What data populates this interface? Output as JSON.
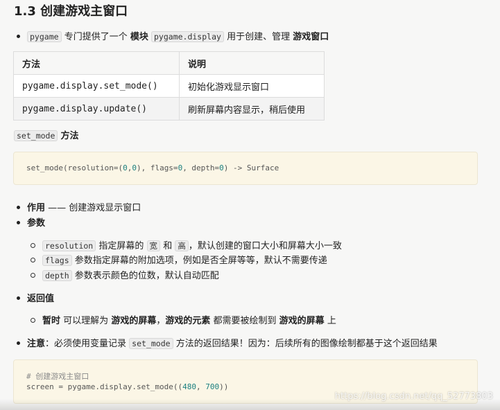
{
  "heading": "1.3 创建游戏主窗口",
  "intro": {
    "code1": "pygame",
    "t1": "专门提供了一个",
    "b1": "模块",
    "code2": "pygame.display",
    "t2": "用于创建、管理",
    "b2": "游戏窗口"
  },
  "table": {
    "headers": [
      "方法",
      "说明"
    ],
    "rows": [
      {
        "method": "pygame.display.set_mode()",
        "desc": "初始化游戏显示窗口"
      },
      {
        "method": "pygame.display.update()",
        "desc": "刷新屏幕内容显示，稍后使用"
      }
    ]
  },
  "setmode_title": {
    "code": "set_mode",
    "text": "方法"
  },
  "codeblock1": {
    "p1": "set_mode(resolution=(",
    "n1": "0",
    "p2": ",",
    "n2": "0",
    "p3": "), flags=",
    "n3": "0",
    "p4": ", depth=",
    "n4": "0",
    "p5": ") -> Surface"
  },
  "purpose": {
    "label": "作用",
    "text": "—— 创建游戏显示窗口"
  },
  "params": {
    "label": "参数",
    "items": [
      {
        "code": "resolution",
        "t1": "指定屏幕的",
        "c2": "宽",
        "t2": "和",
        "c3": "高",
        "t3": "，默认创建的窗口大小和屏幕大小一致"
      },
      {
        "code": "flags",
        "t1": "参数指定屏幕的附加选项，例如是否全屏等等，默认不需要传递"
      },
      {
        "code": "depth",
        "t1": "参数表示颜色的位数，默认自动匹配"
      }
    ]
  },
  "retval": {
    "label": "返回值",
    "b1": "暂时",
    "t1": "可以理解为",
    "b2": "游戏的屏幕",
    "t2": "，",
    "b3": "游戏的元素",
    "t3": "都需要被绘制到",
    "b4": "游戏的屏幕",
    "t4": "上"
  },
  "note": {
    "label": "注意",
    "t1": "：必须使用变量记录",
    "code": "set_mode",
    "t2": "方法的返回结果！因为：后续所有的图像绘制都基于这个返回结果"
  },
  "codeblock2": {
    "comment": "# 创建游戏主窗口",
    "p1": "screen = pygame.display.set_mode((",
    "n1": "480",
    "p2": ", ",
    "n2": "700",
    "p3": "))"
  },
  "watermark": "https://blog.csdn.net/qq_52773803"
}
